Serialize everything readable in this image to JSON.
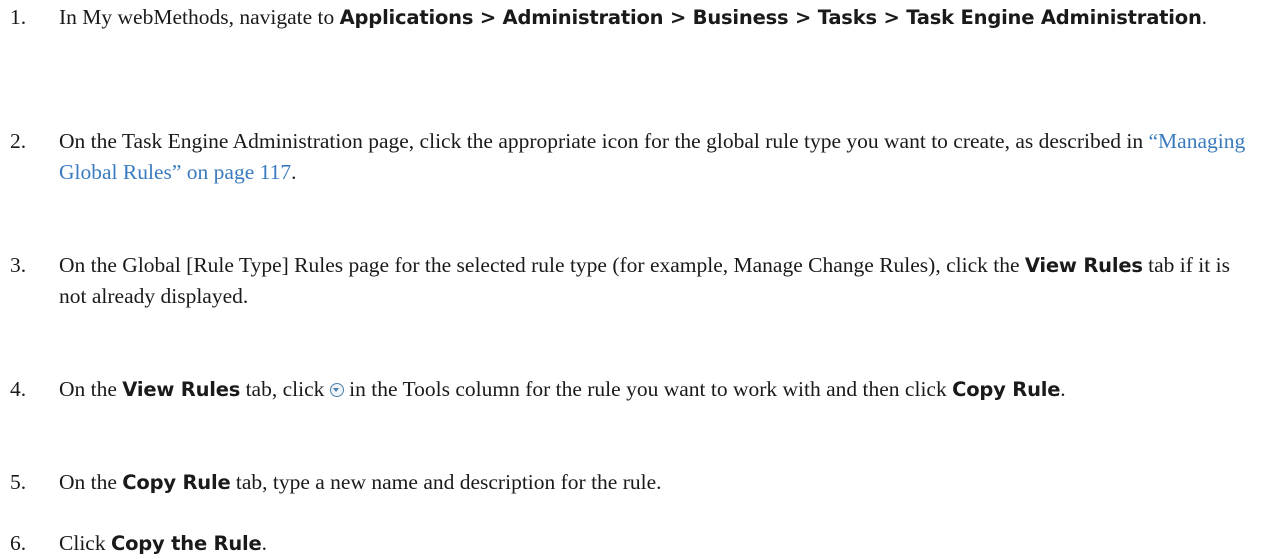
{
  "steps": [
    {
      "number": "1.",
      "text_before": "In My webMethods, navigate to ",
      "bold": "Applications > Administration > Business > Tasks > Task Engine Administration",
      "text_after": "."
    },
    {
      "number": "2.",
      "text_before": "On the Task Engine Administration page, click the appropriate icon for the global rule type you want to create, as described in ",
      "link": "“Managing Global Rules” on page 117",
      "text_after": "."
    },
    {
      "number": "3.",
      "text_before": "On the Global [Rule Type] Rules page for the selected rule type (for example, Manage Change Rules), click the ",
      "bold": "View Rules",
      "text_after": " tab if it is not already displayed."
    },
    {
      "number": "4.",
      "text_before": "On the ",
      "bold": "View Rules",
      "text_mid": " tab, click ",
      "icon": "tools-menu-icon",
      "text_mid2": " in the Tools column for the rule you want to work with and then click ",
      "bold2": "Copy Rule",
      "text_after": "."
    },
    {
      "number": "5.",
      "text_before": "On the ",
      "bold": "Copy Rule",
      "text_after": " tab, type a new name and description for the rule."
    },
    {
      "number": "6.",
      "text_before": "Click ",
      "bold": "Copy the Rule",
      "text_after": "."
    }
  ],
  "colors": {
    "link": "#3a7bbf",
    "text": "#1a1a1a"
  }
}
